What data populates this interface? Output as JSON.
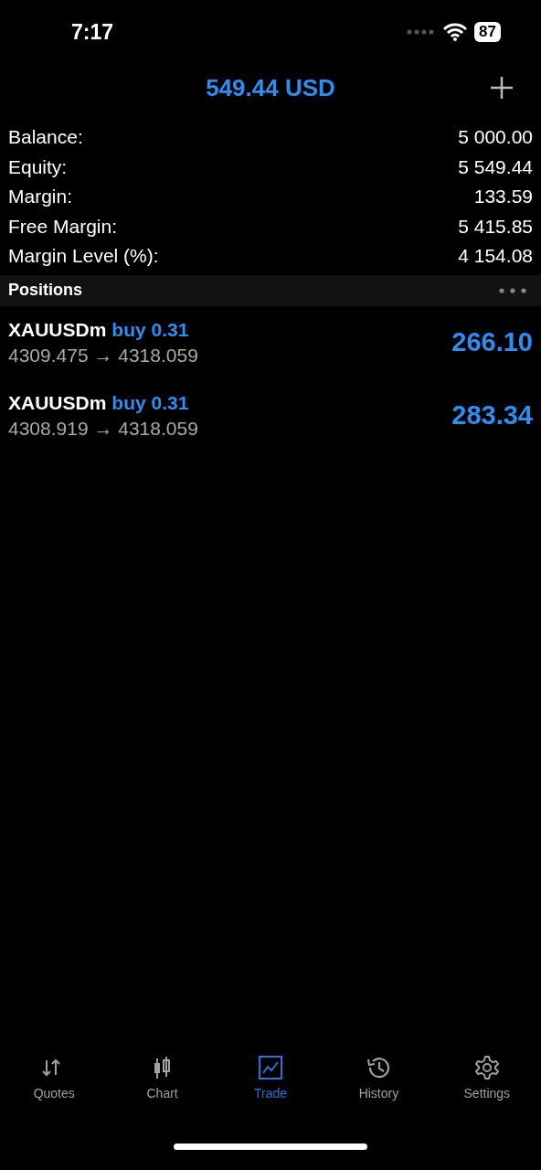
{
  "status_bar": {
    "time": "7:17",
    "battery": "87"
  },
  "header": {
    "title": "549.44 USD"
  },
  "account": [
    {
      "label": "Balance:",
      "value": "5 000.00"
    },
    {
      "label": "Equity:",
      "value": "5 549.44"
    },
    {
      "label": "Margin:",
      "value": "133.59"
    },
    {
      "label": "Free Margin:",
      "value": "5 415.85"
    },
    {
      "label": "Margin Level (%):",
      "value": "4 154.08"
    }
  ],
  "positions_header": {
    "title": "Positions"
  },
  "positions": [
    {
      "symbol": "XAUUSDm",
      "order": "buy 0.31",
      "prices": "4309.475 → 4318.059",
      "profit": "266.10"
    },
    {
      "symbol": "XAUUSDm",
      "order": "buy 0.31",
      "prices": "4308.919 → 4318.059",
      "profit": "283.34"
    }
  ],
  "tab_bar": [
    {
      "kind": "quotes",
      "label": "Quotes",
      "selected": false
    },
    {
      "kind": "chart",
      "label": "Chart",
      "selected": false
    },
    {
      "kind": "trade",
      "label": "Trade",
      "selected": true
    },
    {
      "kind": "history",
      "label": "History",
      "selected": false
    },
    {
      "kind": "settings",
      "label": "Settings",
      "selected": false
    }
  ]
}
